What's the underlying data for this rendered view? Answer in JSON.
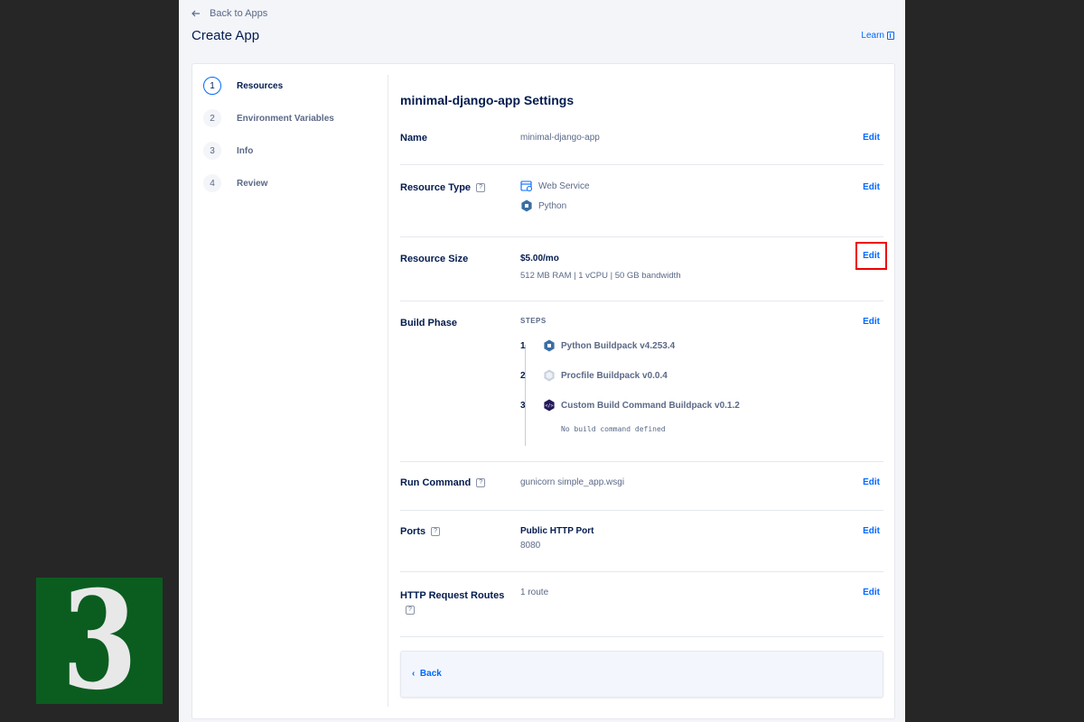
{
  "header": {
    "back_label": "Back to Apps",
    "title": "Create App",
    "learn_label": "Learn"
  },
  "stepper": [
    {
      "num": "1",
      "label": "Resources"
    },
    {
      "num": "2",
      "label": "Environment Variables"
    },
    {
      "num": "3",
      "label": "Info"
    },
    {
      "num": "4",
      "label": "Review"
    }
  ],
  "settings": {
    "title": "minimal-django-app Settings",
    "edit_label": "Edit",
    "name": {
      "label": "Name",
      "value": "minimal-django-app"
    },
    "resource_type": {
      "label": "Resource Type",
      "service": "Web Service",
      "runtime": "Python"
    },
    "resource_size": {
      "label": "Resource Size",
      "price": "$5.00/mo",
      "desc": "512 MB RAM | 1 vCPU | 50 GB bandwidth"
    },
    "build_phase": {
      "label": "Build Phase",
      "steps_head": "STEPS",
      "buildpacks": [
        {
          "num": "1",
          "name": "Python Buildpack v4.253.4"
        },
        {
          "num": "2",
          "name": "Procfile Buildpack v0.0.4"
        },
        {
          "num": "3",
          "name": "Custom Build Command Buildpack v0.1.2"
        }
      ],
      "note": "No build command defined"
    },
    "run_command": {
      "label": "Run Command",
      "value": "gunicorn simple_app.wsgi"
    },
    "ports": {
      "label": "Ports",
      "port_name": "Public HTTP Port",
      "port_num": "8080"
    },
    "routes": {
      "label": "HTTP Request Routes",
      "value": "1 route"
    },
    "help_glyph": "?"
  },
  "footer": {
    "back_label": "Back"
  },
  "badge": {
    "text": "3"
  },
  "colors": {
    "accent": "#0069ff",
    "highlight": "#e00000",
    "badge_bg": "#0a5d1f"
  }
}
